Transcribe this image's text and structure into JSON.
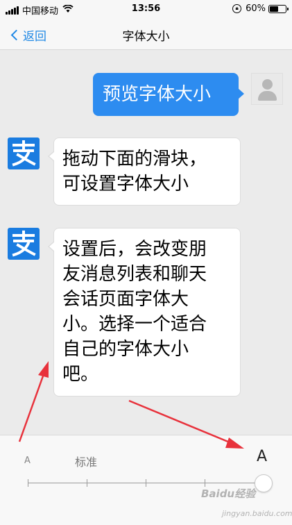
{
  "status_bar": {
    "carrier": "中国移动",
    "time": "13:56",
    "battery": "60%",
    "battery_level": 0.6
  },
  "nav": {
    "back_label": "返回",
    "title": "字体大小"
  },
  "messages": [
    {
      "side": "right",
      "text": "预览字体大小"
    },
    {
      "side": "left",
      "text": "拖动下面的滑块，\n可设置字体大小"
    },
    {
      "side": "left",
      "text": "设置后，会改变朋\n友消息列表和聊天\n会话页面字体大\n小。选择一个适合\n自己的字体大小\n吧。"
    }
  ],
  "avatars": {
    "bot_glyph": "支"
  },
  "font_slider": {
    "small_label": "A",
    "standard_label": "标准",
    "large_label": "A",
    "steps": 5,
    "selected_step": 5
  },
  "watermark": {
    "text": "Baidu经验",
    "sub": "jingyan.baidu.com"
  },
  "colors": {
    "accent": "#2d8cf0",
    "bot_avatar": "#1a7ce0",
    "annotation_arrow": "#e8323c"
  },
  "icons": {
    "back": "chevron-left-icon",
    "wifi": "wifi-icon",
    "orientation_lock": "orientation-lock-icon",
    "battery": "battery-icon"
  }
}
